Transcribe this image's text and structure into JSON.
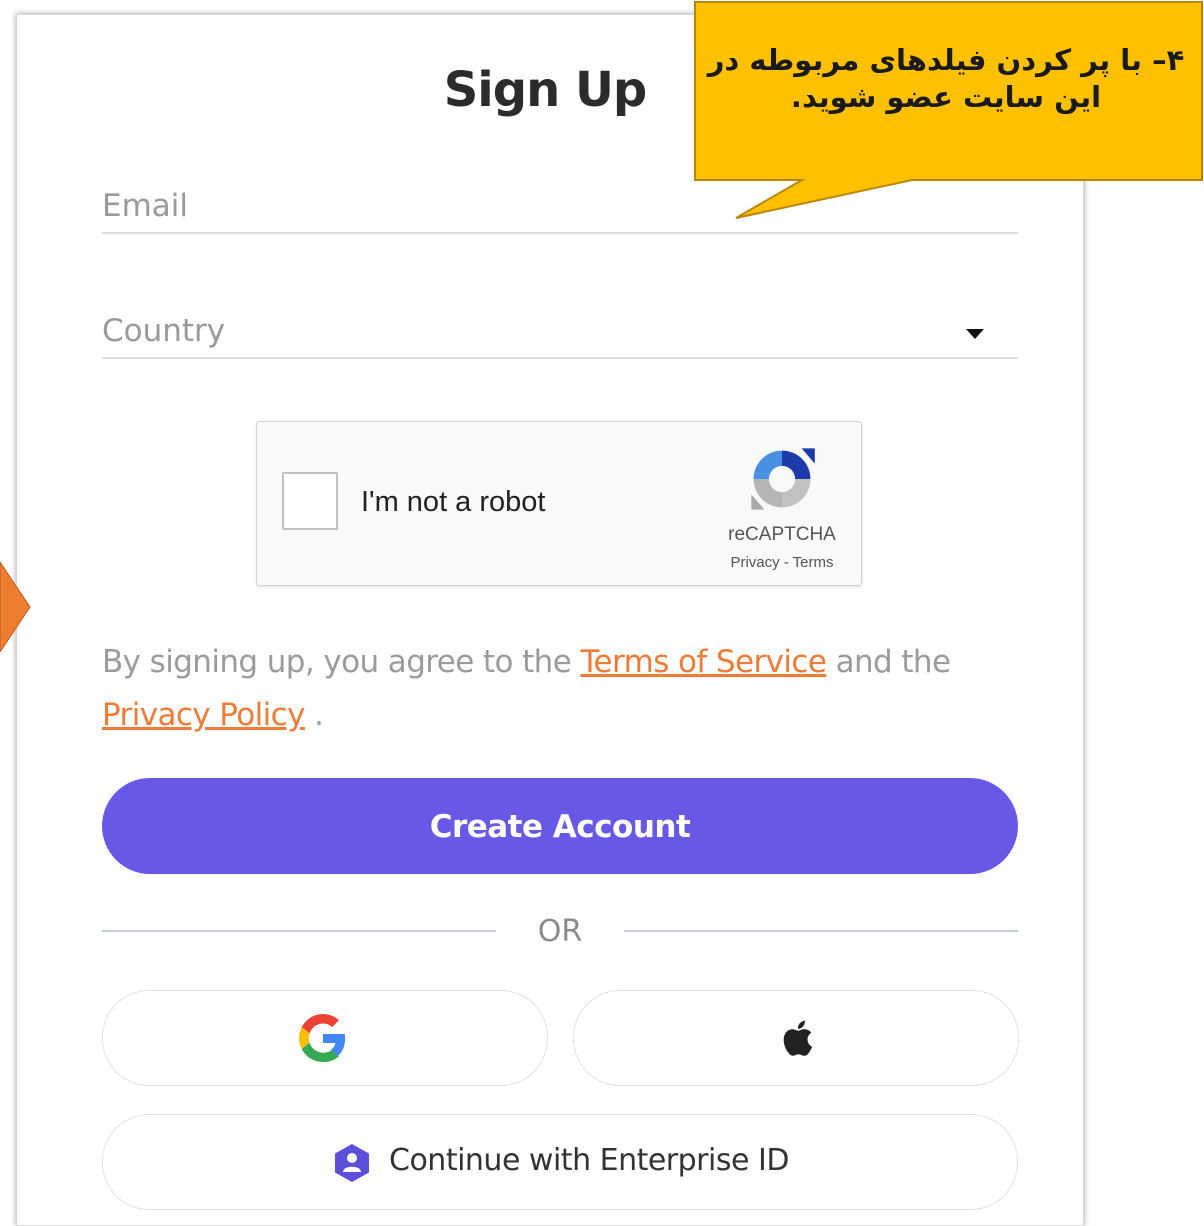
{
  "form": {
    "title": "Sign Up",
    "email_placeholder": "Email",
    "country_placeholder": "Country",
    "captcha": {
      "label": "I'm not a robot",
      "brand": "reCAPTCHA",
      "links": "Privacy - Terms"
    },
    "agreement": {
      "prefix": "By signing up, you agree to the",
      "terms_link": "Terms of Service",
      "middle": "and the",
      "privacy_link": "Privacy Policy",
      "suffix": "."
    },
    "create_button": "Create Account",
    "divider_text": "OR",
    "social": {
      "google_icon": "google-icon",
      "apple_icon": "apple-icon"
    },
    "enterprise_button": "Continue with Enterprise ID"
  },
  "annotation": {
    "callout_text": "۴– با پر کردن فیلدهای مربوطه در این سایت عضو شوید.",
    "colors": {
      "callout_fill": "#ffc000",
      "pointer_fill": "#ed7d31"
    }
  },
  "colors": {
    "primary": "#6759e6",
    "link": "#ee7b36",
    "placeholder": "#9a9a9a"
  }
}
